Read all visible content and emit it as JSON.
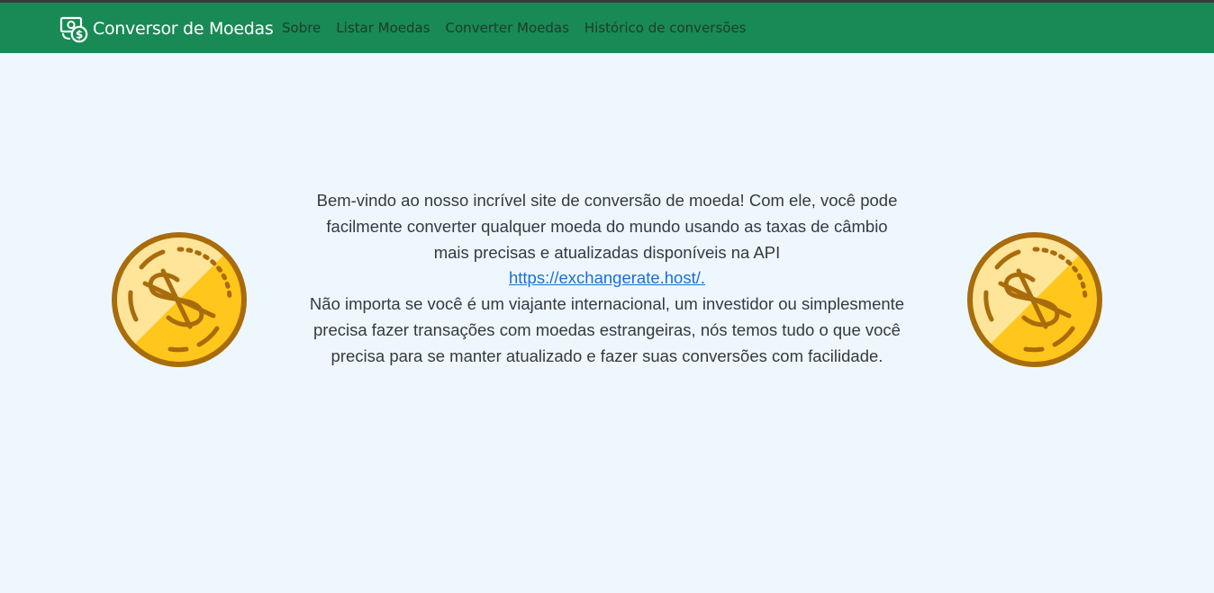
{
  "navbar": {
    "brand_title": "Conversor de Moedas",
    "brand_icon": "money-exchange-icon",
    "links": [
      {
        "label": "Sobre"
      },
      {
        "label": "Listar Moedas"
      },
      {
        "label": "Converter Moedas"
      },
      {
        "label": "Histórico de conversões"
      }
    ]
  },
  "intro": {
    "paragraph1": "Bem-vindo ao nosso incrível site de conversão de moeda! Com ele, você pode facilmente converter qualquer moeda do mundo usando as taxas de câmbio mais precisas e atualizadas disponíveis na API",
    "api_link": "https://exchangerate.host/.",
    "paragraph2": "Não importa se você é um viajante internacional, um investidor ou simplesmente precisa fazer transações com moedas estrangeiras, nós temos tudo o que você precisa para se manter atualizado e fazer suas conversões com facilidade."
  },
  "decorations": {
    "left_icon": "dollar-coin-icon",
    "right_icon": "dollar-coin-icon"
  },
  "colors": {
    "navbar_bg": "#198a55",
    "page_bg": "#eff7fe",
    "link": "#1a6fd8",
    "coin_gold": "#ffc61b",
    "coin_light": "#ffe59a",
    "coin_outline": "#a86c0c"
  }
}
